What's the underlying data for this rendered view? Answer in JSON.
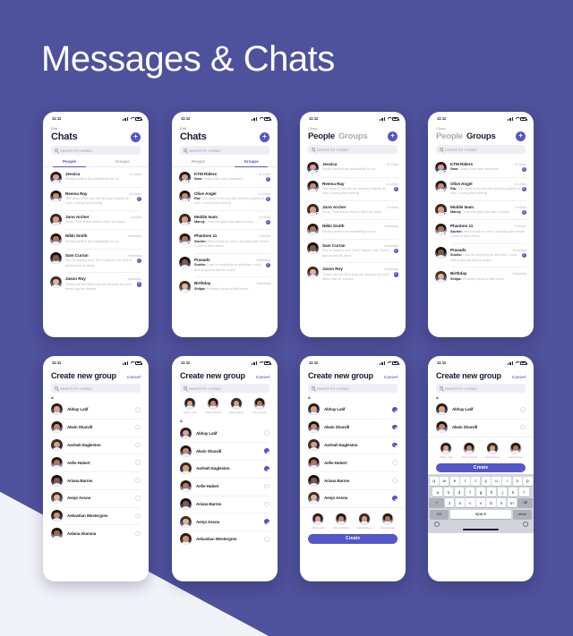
{
  "title": "Messages & Chats",
  "colors": {
    "background": "#4e519b",
    "accent": "#5457c7",
    "wedge": "#f2f3f8",
    "text_dark": "#1b1c2e",
    "text_muted": "#b6b7c4"
  },
  "status_bar": {
    "time": "11:11"
  },
  "common": {
    "search_placeholder": "Search for contact",
    "edit_label": "Edit",
    "chats_label": "Chats",
    "people_label": "People",
    "groups_label": "Groups",
    "plus_label": "+",
    "create_new_group_title": "Create new group",
    "cancel_label": "Cancel",
    "section_letter": "A",
    "create_label": "Create"
  },
  "screens": [
    {
      "id": "chats-people",
      "header_style": "title",
      "title": "Chats",
      "top_label": "Edit",
      "tabs": [
        {
          "label": "People",
          "active": true
        },
        {
          "label": "Groups",
          "active": false
        }
      ],
      "rows": [
        {
          "name": "Jessica",
          "time": "12:11am",
          "preview": "Kindly confirm the availability for us...",
          "sender": "",
          "unread": "",
          "online": true
        },
        {
          "name": "Reema Ray",
          "time": "11:10am",
          "preview": "The stars in the sky are shining brightly as ever. Loving the evening",
          "sender": "",
          "unread": "2",
          "online": true
        },
        {
          "name": "Juno Archer",
          "time": "9:10am",
          "preview": "Sorry. That sheet need to filed for today",
          "sender": "",
          "unread": "",
          "online": true
        },
        {
          "name": "Nikki Smith",
          "time": "Yesterday",
          "preview": "Kindly confirm the availability for us...",
          "sender": "",
          "unread": "",
          "online": false
        },
        {
          "name": "Sam Curran",
          "time": "Yesterday",
          "preview": "She is looking over The 2 banner out. Got to gonna and its done.",
          "sender": "",
          "unread": "1",
          "online": false
        },
        {
          "name": "Jason Roy",
          "time": "Yesterday",
          "preview": "These are the films that are already live and items can be shared.",
          "sender": "",
          "unread": "3",
          "online": false
        }
      ]
    },
    {
      "id": "chats-groups",
      "header_style": "title",
      "title": "Chats",
      "top_label": "Edit",
      "tabs": [
        {
          "label": "People",
          "active": false
        },
        {
          "label": "Groups",
          "active": true
        }
      ],
      "rows": [
        {
          "name": "KTM Riders",
          "time": "12:11am",
          "preview": "Status filter was awesome",
          "sender": "Sam:",
          "unread": "2",
          "online": true
        },
        {
          "name": "Olive Angel",
          "time": "11:10am",
          "preview": "The stars in the sky are shining brightly as ever. Loving the evening",
          "sender": "Ria:",
          "unread": "5",
          "online": true
        },
        {
          "name": "Mobile team",
          "time": "9:10am",
          "preview": "I love the grid ratio site is lovely",
          "sender": "Manoj:",
          "unread": "1",
          "online": true
        },
        {
          "name": "Phantom 11",
          "time": "9:06 pm",
          "preview": "Went head on hard 1 at bass side heads. Come in blue dress",
          "sender": "Sachin:",
          "unread": "",
          "online": true
        },
        {
          "name": "Prasads",
          "time": "Yesterday",
          "preview": "I can do anything for attention. Look how to gonna and its share.",
          "sender": "Sunita:",
          "unread": "2",
          "online": false
        },
        {
          "name": "Birthday",
          "time": "Yesterday",
          "preview": "Probably about a little move",
          "sender": "Shilpa:",
          "unread": "",
          "online": false
        }
      ]
    },
    {
      "id": "people-groups-people",
      "header_style": "segment",
      "top_label": "Chats",
      "segments": [
        {
          "label": "People",
          "active": true
        },
        {
          "label": "Groups",
          "active": false
        }
      ],
      "rows": [
        {
          "name": "Jessica",
          "time": "12:11am",
          "preview": "Kindly confirm the availability for us...",
          "sender": "",
          "unread": "",
          "online": true
        },
        {
          "name": "Reema Ray",
          "time": "11:10am",
          "preview": "The stars in the sky are shining brightly as ever. Loving the evening",
          "sender": "",
          "unread": "2",
          "online": true
        },
        {
          "name": "Juno Archer",
          "time": "9:10am",
          "preview": "Sorry. That sheet need to filed for today",
          "sender": "",
          "unread": "",
          "online": true
        },
        {
          "name": "Nikki Smith",
          "time": "Yesterday",
          "preview": "Kindly confirm the availability for us...",
          "sender": "",
          "unread": "",
          "online": false
        },
        {
          "name": "Sam Curran",
          "time": "Yesterday",
          "preview": "She is looking over The 2 banner out. Got to gonna and its done.",
          "sender": "",
          "unread": "1",
          "online": false
        },
        {
          "name": "Jason Roy",
          "time": "Yesterday",
          "preview": "These are the films that are already live and items can be shared.",
          "sender": "",
          "unread": "3",
          "online": false
        }
      ]
    },
    {
      "id": "people-groups-groups",
      "header_style": "segment",
      "top_label": "Chats",
      "segments": [
        {
          "label": "People",
          "active": false
        },
        {
          "label": "Groups",
          "active": true
        }
      ],
      "rows": [
        {
          "name": "KTM Riders",
          "time": "12:11am",
          "preview": "Status filter was awesome",
          "sender": "Sam:",
          "unread": "2",
          "online": true
        },
        {
          "name": "Olive Angel",
          "time": "11:10am",
          "preview": "The stars in the sky are shining brightly as ever. Loving the evening",
          "sender": "Ria:",
          "unread": "5",
          "online": true
        },
        {
          "name": "Mobile team",
          "time": "9:10am",
          "preview": "I love the grid ratio site is lovely",
          "sender": "Manoj:",
          "unread": "1",
          "online": true
        },
        {
          "name": "Phantom 11",
          "time": "9:06 pm",
          "preview": "Went head on hard 1 at bass side heads. Come in blue dress",
          "sender": "Sachin:",
          "unread": "",
          "online": true
        },
        {
          "name": "Prasads",
          "time": "Yesterday",
          "preview": "I can do anything for attention. Look how to gonna and its share.",
          "sender": "Sunita:",
          "unread": "2",
          "online": false
        },
        {
          "name": "Birthday",
          "time": "Yesterday",
          "preview": "Probably about a little move",
          "sender": "Shilpa:",
          "unread": "",
          "online": false
        }
      ]
    }
  ],
  "group_screens": [
    {
      "id": "create-group-empty",
      "show_strip": false,
      "show_create": false,
      "show_keyboard": false,
      "contacts": [
        {
          "name": "Abhay Latif",
          "selected": false
        },
        {
          "name": "Alwin Sharvill",
          "selected": false
        },
        {
          "name": "Aarleah Eagleston",
          "selected": false
        },
        {
          "name": "Aefie Hubert",
          "selected": false
        },
        {
          "name": "Ariana Barros",
          "selected": false
        },
        {
          "name": "Aenjo Assou",
          "selected": false
        },
        {
          "name": "Aebastian Westergren",
          "selected": false
        },
        {
          "name": "Aalana Akarana",
          "selected": false
        }
      ]
    },
    {
      "id": "create-group-strip",
      "show_strip": true,
      "show_create": false,
      "show_keyboard": false,
      "selected_avatars": [
        {
          "label": "Abhay Latif"
        },
        {
          "label": "Alwin Sharvill"
        },
        {
          "label": "Aarleah Eag."
        },
        {
          "label": "Aenjo Assou"
        }
      ],
      "contacts": [
        {
          "name": "Abhay Latif",
          "selected": false
        },
        {
          "name": "Alwin Sharvill",
          "selected": true
        },
        {
          "name": "Aarleah Eagleston",
          "selected": true
        },
        {
          "name": "Aefie Hubert",
          "selected": false
        },
        {
          "name": "Ariana Barros",
          "selected": false
        },
        {
          "name": "Aenjo Assou",
          "selected": true
        },
        {
          "name": "Aebastian Westergren",
          "selected": false
        }
      ]
    },
    {
      "id": "create-group-create",
      "show_strip": false,
      "show_create": true,
      "show_keyboard": false,
      "selected_avatars": [
        {
          "label": "Abhay Latif"
        },
        {
          "label": "Alwin Sharvill"
        },
        {
          "label": "Aarleah Eag."
        },
        {
          "label": "Aenjo Assou"
        }
      ],
      "contacts": [
        {
          "name": "Abhay Latif",
          "selected": true
        },
        {
          "name": "Alwin Sharvill",
          "selected": true
        },
        {
          "name": "Aarleah Eagleston",
          "selected": true
        },
        {
          "name": "Aefie Hubert",
          "selected": false
        },
        {
          "name": "Ariana Barros",
          "selected": false
        },
        {
          "name": "Aenjo Assou",
          "selected": true
        }
      ]
    },
    {
      "id": "create-group-keyboard",
      "show_strip": false,
      "show_create": true,
      "show_keyboard": true,
      "selected_avatars": [
        {
          "label": "Abhay Latif"
        },
        {
          "label": "Alwin Sharvill"
        },
        {
          "label": "Aarleah Eag."
        },
        {
          "label": "Aenjo Assou"
        }
      ],
      "contacts": [
        {
          "name": "Abhay Latif",
          "selected": false
        },
        {
          "name": "Alwin Sharvill",
          "selected": false
        }
      ]
    }
  ],
  "keyboard": {
    "row1": [
      "q",
      "w",
      "e",
      "r",
      "t",
      "y",
      "u",
      "i",
      "o",
      "p"
    ],
    "row2": [
      "a",
      "s",
      "d",
      "f",
      "g",
      "h",
      "j",
      "k",
      "l"
    ],
    "row3": [
      "z",
      "x",
      "c",
      "v",
      "b",
      "n",
      "m"
    ],
    "shift_label": "⇧",
    "backspace_label": "⌫",
    "numbers_label": "123",
    "space_label": "space",
    "return_label": "return",
    "emoji_icon": "emoji-icon",
    "mic_icon": "microphone-icon"
  }
}
